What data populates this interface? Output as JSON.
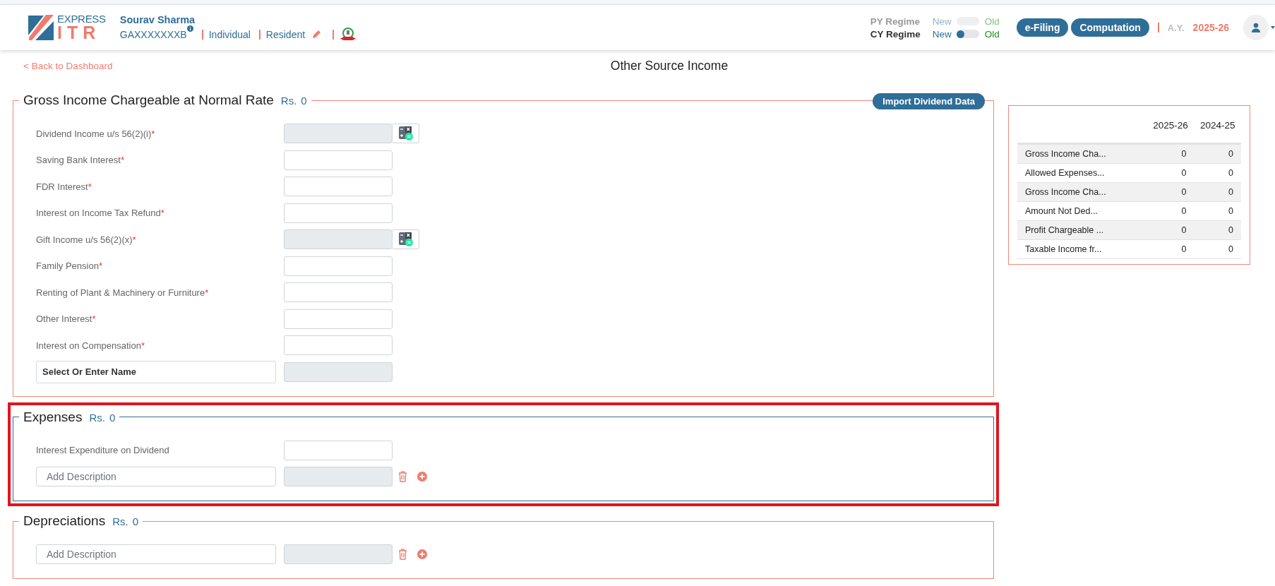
{
  "header": {
    "logo": {
      "top": "EXPRESS",
      "bottom": "ITR"
    },
    "user": {
      "name": "Sourav Sharma",
      "pan": "GAXXXXXXXB",
      "status": "Individual",
      "residency": "Resident"
    },
    "regimes": [
      {
        "label": "PY Regime",
        "new": "New",
        "old": "Old",
        "disabled": true,
        "old_selected": false
      },
      {
        "label": "CY Regime",
        "new": "New",
        "old": "Old",
        "disabled": false,
        "old_selected": false
      }
    ],
    "buttons": [
      "e-Filing",
      "Computation"
    ],
    "ay_label": "A.Y.",
    "ay_value": "2025-26"
  },
  "back_link": "< Back to Dashboard",
  "page_title": "Other Source Income",
  "sections": [
    {
      "title": "Gross Income Chargeable at Normal Rate",
      "currency": "Rs.",
      "amount": "0",
      "active": false,
      "highlighted": false,
      "action": "Import Dividend Data",
      "rows": [
        {
          "kind": "calc",
          "label": "Dividend Income u/s 56(2)(i)",
          "mark": "*"
        },
        {
          "kind": "input",
          "label": "Saving Bank Interest",
          "mark": "*"
        },
        {
          "kind": "input",
          "label": "FDR Interest",
          "mark": "*"
        },
        {
          "kind": "input",
          "label": "Interest on Income Tax Refund",
          "mark": "*"
        },
        {
          "kind": "calc",
          "label": "Gift Income u/s 56(2)(x)",
          "mark": "*"
        },
        {
          "kind": "input",
          "label": "Family Pension",
          "mark": "*"
        },
        {
          "kind": "input",
          "label": "Renting of Plant & Machinery or Furniture",
          "mark": "*"
        },
        {
          "kind": "input",
          "label": "Other Interest",
          "mark": "*"
        },
        {
          "kind": "input",
          "label": "Interest on Compensation",
          "mark": "*"
        },
        {
          "kind": "name",
          "placeholder": "Select Or Enter Name"
        }
      ]
    },
    {
      "title": "Expenses",
      "currency": "Rs.",
      "amount": "0",
      "active": true,
      "highlighted": true,
      "rows": [
        {
          "kind": "input",
          "label": "Interest Expenditure on Dividend"
        },
        {
          "kind": "description",
          "placeholder": "Add Description"
        }
      ]
    },
    {
      "title": "Depreciations",
      "currency": "Rs.",
      "amount": "0",
      "active": false,
      "highlighted": false,
      "rows": [
        {
          "kind": "description",
          "placeholder": "Add Description"
        }
      ]
    }
  ],
  "summary": {
    "columns": [
      "2025-26",
      "2024-25"
    ],
    "rows": [
      {
        "label": "Gross Income Cha...",
        "values": [
          "0",
          "0"
        ]
      },
      {
        "label": "Allowed Expenses...",
        "values": [
          "0",
          "0"
        ]
      },
      {
        "label": "Gross Income Cha...",
        "values": [
          "0",
          "0"
        ]
      },
      {
        "label": "Amount Not Ded...",
        "values": [
          "0",
          "0"
        ]
      },
      {
        "label": "Profit Chargeable ...",
        "values": [
          "0",
          "0"
        ]
      },
      {
        "label": "Taxable Income fr...",
        "values": [
          "0",
          "0"
        ]
      }
    ]
  }
}
